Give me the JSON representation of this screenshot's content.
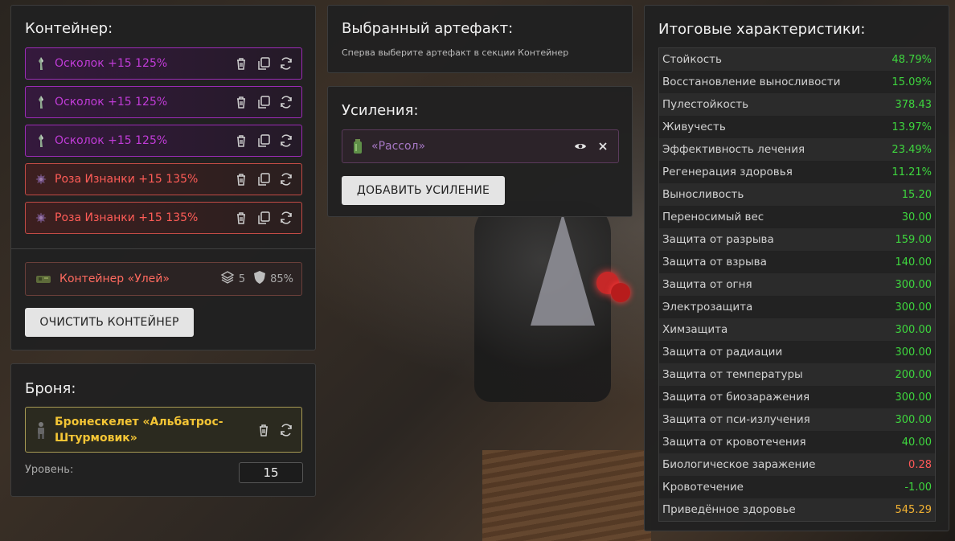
{
  "colors": {
    "accent_purple": "#c13cd8",
    "accent_red": "#ff5c57",
    "positive": "#3ed63e",
    "negative": "#ff5858",
    "gold": "#f2b233"
  },
  "container": {
    "title": "Контейнер:",
    "artifacts": [
      {
        "name": "Осколок +15 125%",
        "color": "purple",
        "icon": "shard-icon"
      },
      {
        "name": "Осколок +15 125%",
        "color": "purple",
        "icon": "shard-icon"
      },
      {
        "name": "Осколок +15 125%",
        "color": "purple",
        "icon": "shard-icon"
      },
      {
        "name": "Роза Изнанки +15 135%",
        "color": "red",
        "icon": "rose-icon"
      },
      {
        "name": "Роза Изнанки +15 135%",
        "color": "red",
        "icon": "rose-icon"
      }
    ],
    "container_item": {
      "name": "Контейнер «Улей»",
      "slots": "5",
      "protection": "85%"
    },
    "clear_button": "ОЧИСТИТЬ КОНТЕЙНЕР"
  },
  "armor": {
    "title": "Броня:",
    "name": "Бронескелет «Альбатрос-Штурмовик»",
    "name_line1": "Бронескелет «Альбатрос-",
    "name_line2": "Штурмовик»",
    "level_label": "Уровень:",
    "level_value": "15"
  },
  "selected": {
    "title": "Выбранный артефакт:",
    "hint": "Сперва выберите артефакт в секции Контейнер"
  },
  "boosts": {
    "title": "Усиления:",
    "items": [
      {
        "name": "«Рассол»"
      }
    ],
    "add_button": "ДОБАВИТЬ УСИЛЕНИЕ"
  },
  "stats": {
    "title": "Итоговые характеристики:",
    "rows": [
      {
        "label": "Стойкость",
        "value": "48.79%",
        "tone": "pos"
      },
      {
        "label": "Восстановление выносливости",
        "value": "15.09%",
        "tone": "pos"
      },
      {
        "label": "Пулестойкость",
        "value": "378.43",
        "tone": "pos"
      },
      {
        "label": "Живучесть",
        "value": "13.97%",
        "tone": "pos"
      },
      {
        "label": "Эффективность лечения",
        "value": "23.49%",
        "tone": "pos"
      },
      {
        "label": "Регенерация здоровья",
        "value": "11.21%",
        "tone": "pos"
      },
      {
        "label": "Выносливость",
        "value": "15.20",
        "tone": "pos"
      },
      {
        "label": "Переносимый вес",
        "value": "30.00",
        "tone": "pos"
      },
      {
        "label": "Защита от разрыва",
        "value": "159.00",
        "tone": "pos"
      },
      {
        "label": "Защита от взрыва",
        "value": "140.00",
        "tone": "pos"
      },
      {
        "label": "Защита от огня",
        "value": "300.00",
        "tone": "pos"
      },
      {
        "label": "Электрозащита",
        "value": "300.00",
        "tone": "pos"
      },
      {
        "label": "Химзащита",
        "value": "300.00",
        "tone": "pos"
      },
      {
        "label": "Защита от радиации",
        "value": "300.00",
        "tone": "pos"
      },
      {
        "label": "Защита от температуры",
        "value": "200.00",
        "tone": "pos"
      },
      {
        "label": "Защита от биозаражения",
        "value": "300.00",
        "tone": "pos"
      },
      {
        "label": "Защита от пси-излучения",
        "value": "300.00",
        "tone": "pos"
      },
      {
        "label": "Защита от кровотечения",
        "value": "40.00",
        "tone": "pos"
      },
      {
        "label": "Биологическое заражение",
        "value": "0.28",
        "tone": "neg"
      },
      {
        "label": "Кровотечение",
        "value": "-1.00",
        "tone": "pos"
      },
      {
        "label": "Приведённое здоровье",
        "value": "545.29",
        "tone": "gold"
      }
    ]
  }
}
